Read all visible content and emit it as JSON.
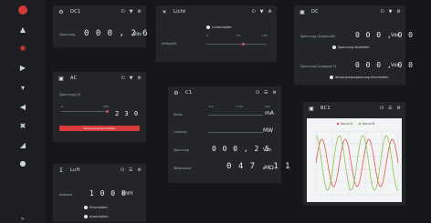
{
  "sidebar": {
    "items": [
      {
        "icon": "logo-icon"
      },
      {
        "icon": "school-icon"
      },
      {
        "icon": "target-icon"
      },
      {
        "icon": "play-icon"
      },
      {
        "icon": "network-icon"
      },
      {
        "icon": "volume-icon"
      },
      {
        "icon": "tools-icon"
      },
      {
        "icon": "signal-icon"
      },
      {
        "icon": "user-icon"
      },
      {
        "icon": "expand-icon"
      }
    ]
  },
  "panels": {
    "dc1": {
      "title": "DC1",
      "field_label": "Spannung",
      "value": "0 0 0 , 2 6",
      "unit": "Vdc"
    },
    "licht": {
      "title": "Licht",
      "toggle_label": "Lichtschalter",
      "slider_label": "Helligkeit",
      "scale": [
        "0",
        "50",
        "100"
      ]
    },
    "dc": {
      "title": "DC",
      "field1_label": "Spannung (Amplitude)",
      "value1": "0 0 0 , 0 0",
      "unit1": "Vdc",
      "link1": "Spannung einstellen",
      "field2_label": "Spannung (Ausgang V)",
      "value2": "0 0 0 , 0 0",
      "unit2": "Vdc",
      "link2": "Versorgungsspannung einschalten"
    },
    "ac": {
      "title": "AC",
      "field_label": "Spannung (V)",
      "scale_min": "0",
      "scale_max": "230",
      "value": "2 3 0",
      "button": "Versorgung einschalten"
    },
    "c1": {
      "title": "C1",
      "scale": [
        "-0.5",
        "1 mA",
        "100"
      ],
      "row1_label": "Strom",
      "row1_unit": "mA",
      "row2_label": "Leistung",
      "row2_unit": "MW",
      "row3_label": "Spannung",
      "row3_value": "0 0 0 , 2 5",
      "row3_unit": "Vdc",
      "row4_label": "Widerstand",
      "row4_value": "0 4 7 , 1 1",
      "row4_unit": "MΩ"
    },
    "bc1": {
      "title": "BC1",
      "legend": [
        "Kanal A",
        "Kanal B"
      ]
    },
    "luft": {
      "title": "Luft",
      "field_label": "Abstand",
      "value": "1 0 0 0",
      "unit": "mm",
      "link1": "Einschalten",
      "link2": "Ausschalten"
    }
  },
  "colors": {
    "background": "#15171b",
    "panel": "#232529",
    "accent_red": "#d63a3a",
    "series_a": "#e0564f",
    "series_b": "#8bc34a"
  }
}
